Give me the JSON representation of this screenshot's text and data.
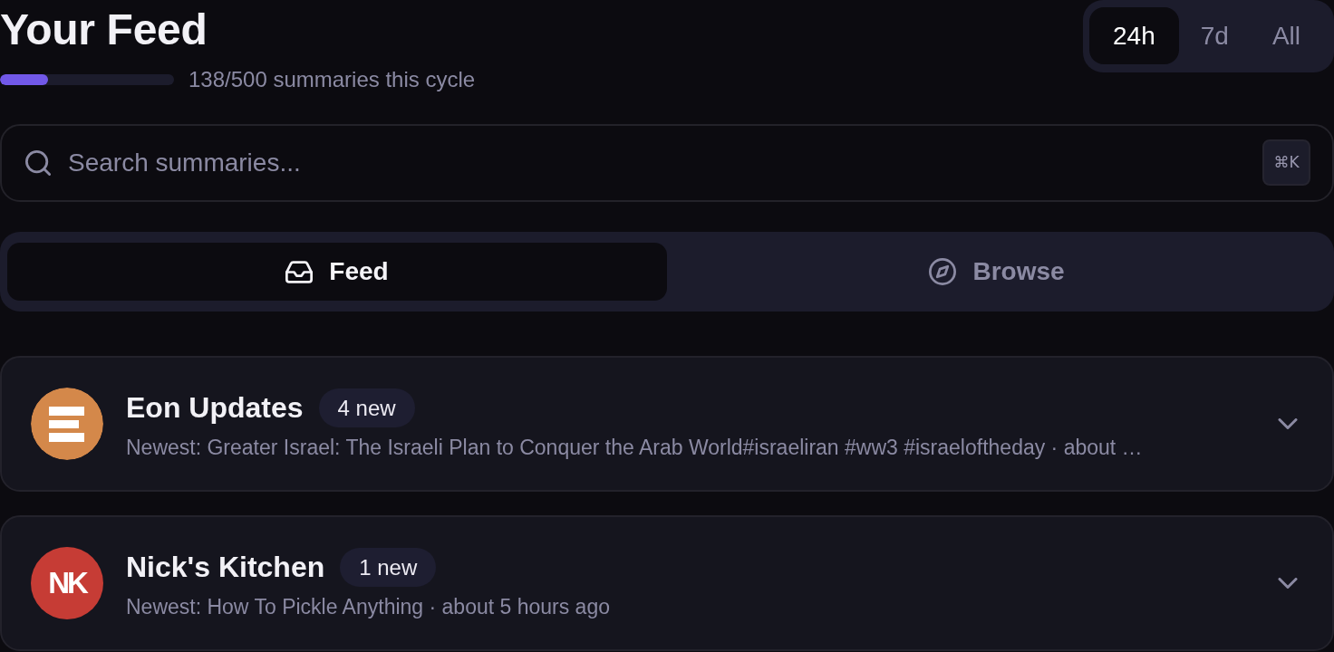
{
  "header": {
    "title": "Your Feed",
    "usage": {
      "level": 0.276,
      "label": "138/500 summaries this cycle"
    }
  },
  "range_tabs": [
    {
      "label": "24h",
      "selected": true
    },
    {
      "label": "7d",
      "selected": false
    },
    {
      "label": "All",
      "selected": false
    }
  ],
  "search": {
    "placeholder": "Search summaries...",
    "shortcut": "⌘K"
  },
  "view_tabs": [
    {
      "label": "Feed",
      "selected": true
    },
    {
      "label": "Browse",
      "selected": false
    }
  ],
  "channels": [
    {
      "name": "Eon Updates",
      "badge": "4 new",
      "newest": "Newest: Greater Israel: The Israeli Plan to Conquer the Arab World#israeliran #ww3 #israeloftheday · about …",
      "expanded": false,
      "kind": "stripes",
      "color": "#d4884a"
    },
    {
      "name": "Nick's Kitchen",
      "badge": "1 new",
      "newest": "Newest: How To Pickle Anything · about 5 hours ago",
      "expanded": false,
      "kind": "monogram",
      "logo_text": "NK",
      "color": "#c63c35"
    }
  ]
}
